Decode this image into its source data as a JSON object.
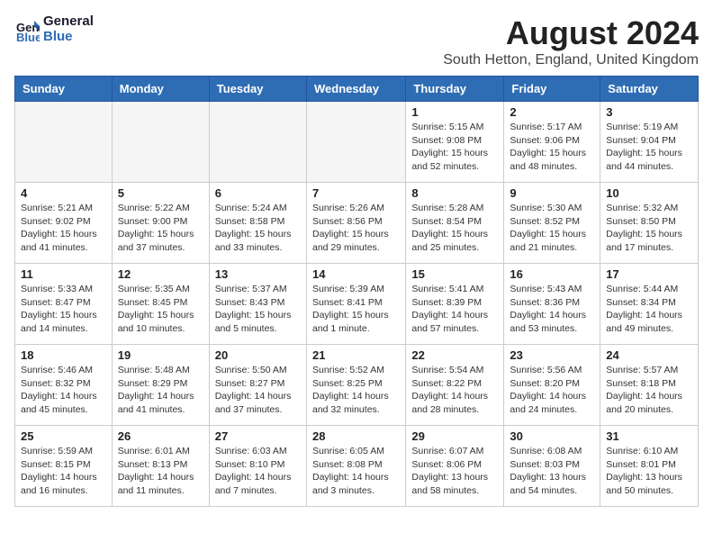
{
  "header": {
    "logo_line1": "General",
    "logo_line2": "Blue",
    "month_title": "August 2024",
    "location": "South Hetton, England, United Kingdom"
  },
  "weekdays": [
    "Sunday",
    "Monday",
    "Tuesday",
    "Wednesday",
    "Thursday",
    "Friday",
    "Saturday"
  ],
  "weeks": [
    [
      {
        "day": "",
        "info": ""
      },
      {
        "day": "",
        "info": ""
      },
      {
        "day": "",
        "info": ""
      },
      {
        "day": "",
        "info": ""
      },
      {
        "day": "1",
        "info": "Sunrise: 5:15 AM\nSunset: 9:08 PM\nDaylight: 15 hours\nand 52 minutes."
      },
      {
        "day": "2",
        "info": "Sunrise: 5:17 AM\nSunset: 9:06 PM\nDaylight: 15 hours\nand 48 minutes."
      },
      {
        "day": "3",
        "info": "Sunrise: 5:19 AM\nSunset: 9:04 PM\nDaylight: 15 hours\nand 44 minutes."
      }
    ],
    [
      {
        "day": "4",
        "info": "Sunrise: 5:21 AM\nSunset: 9:02 PM\nDaylight: 15 hours\nand 41 minutes."
      },
      {
        "day": "5",
        "info": "Sunrise: 5:22 AM\nSunset: 9:00 PM\nDaylight: 15 hours\nand 37 minutes."
      },
      {
        "day": "6",
        "info": "Sunrise: 5:24 AM\nSunset: 8:58 PM\nDaylight: 15 hours\nand 33 minutes."
      },
      {
        "day": "7",
        "info": "Sunrise: 5:26 AM\nSunset: 8:56 PM\nDaylight: 15 hours\nand 29 minutes."
      },
      {
        "day": "8",
        "info": "Sunrise: 5:28 AM\nSunset: 8:54 PM\nDaylight: 15 hours\nand 25 minutes."
      },
      {
        "day": "9",
        "info": "Sunrise: 5:30 AM\nSunset: 8:52 PM\nDaylight: 15 hours\nand 21 minutes."
      },
      {
        "day": "10",
        "info": "Sunrise: 5:32 AM\nSunset: 8:50 PM\nDaylight: 15 hours\nand 17 minutes."
      }
    ],
    [
      {
        "day": "11",
        "info": "Sunrise: 5:33 AM\nSunset: 8:47 PM\nDaylight: 15 hours\nand 14 minutes."
      },
      {
        "day": "12",
        "info": "Sunrise: 5:35 AM\nSunset: 8:45 PM\nDaylight: 15 hours\nand 10 minutes."
      },
      {
        "day": "13",
        "info": "Sunrise: 5:37 AM\nSunset: 8:43 PM\nDaylight: 15 hours\nand 5 minutes."
      },
      {
        "day": "14",
        "info": "Sunrise: 5:39 AM\nSunset: 8:41 PM\nDaylight: 15 hours\nand 1 minute."
      },
      {
        "day": "15",
        "info": "Sunrise: 5:41 AM\nSunset: 8:39 PM\nDaylight: 14 hours\nand 57 minutes."
      },
      {
        "day": "16",
        "info": "Sunrise: 5:43 AM\nSunset: 8:36 PM\nDaylight: 14 hours\nand 53 minutes."
      },
      {
        "day": "17",
        "info": "Sunrise: 5:44 AM\nSunset: 8:34 PM\nDaylight: 14 hours\nand 49 minutes."
      }
    ],
    [
      {
        "day": "18",
        "info": "Sunrise: 5:46 AM\nSunset: 8:32 PM\nDaylight: 14 hours\nand 45 minutes."
      },
      {
        "day": "19",
        "info": "Sunrise: 5:48 AM\nSunset: 8:29 PM\nDaylight: 14 hours\nand 41 minutes."
      },
      {
        "day": "20",
        "info": "Sunrise: 5:50 AM\nSunset: 8:27 PM\nDaylight: 14 hours\nand 37 minutes."
      },
      {
        "day": "21",
        "info": "Sunrise: 5:52 AM\nSunset: 8:25 PM\nDaylight: 14 hours\nand 32 minutes."
      },
      {
        "day": "22",
        "info": "Sunrise: 5:54 AM\nSunset: 8:22 PM\nDaylight: 14 hours\nand 28 minutes."
      },
      {
        "day": "23",
        "info": "Sunrise: 5:56 AM\nSunset: 8:20 PM\nDaylight: 14 hours\nand 24 minutes."
      },
      {
        "day": "24",
        "info": "Sunrise: 5:57 AM\nSunset: 8:18 PM\nDaylight: 14 hours\nand 20 minutes."
      }
    ],
    [
      {
        "day": "25",
        "info": "Sunrise: 5:59 AM\nSunset: 8:15 PM\nDaylight: 14 hours\nand 16 minutes."
      },
      {
        "day": "26",
        "info": "Sunrise: 6:01 AM\nSunset: 8:13 PM\nDaylight: 14 hours\nand 11 minutes."
      },
      {
        "day": "27",
        "info": "Sunrise: 6:03 AM\nSunset: 8:10 PM\nDaylight: 14 hours\nand 7 minutes."
      },
      {
        "day": "28",
        "info": "Sunrise: 6:05 AM\nSunset: 8:08 PM\nDaylight: 14 hours\nand 3 minutes."
      },
      {
        "day": "29",
        "info": "Sunrise: 6:07 AM\nSunset: 8:06 PM\nDaylight: 13 hours\nand 58 minutes."
      },
      {
        "day": "30",
        "info": "Sunrise: 6:08 AM\nSunset: 8:03 PM\nDaylight: 13 hours\nand 54 minutes."
      },
      {
        "day": "31",
        "info": "Sunrise: 6:10 AM\nSunset: 8:01 PM\nDaylight: 13 hours\nand 50 minutes."
      }
    ]
  ]
}
